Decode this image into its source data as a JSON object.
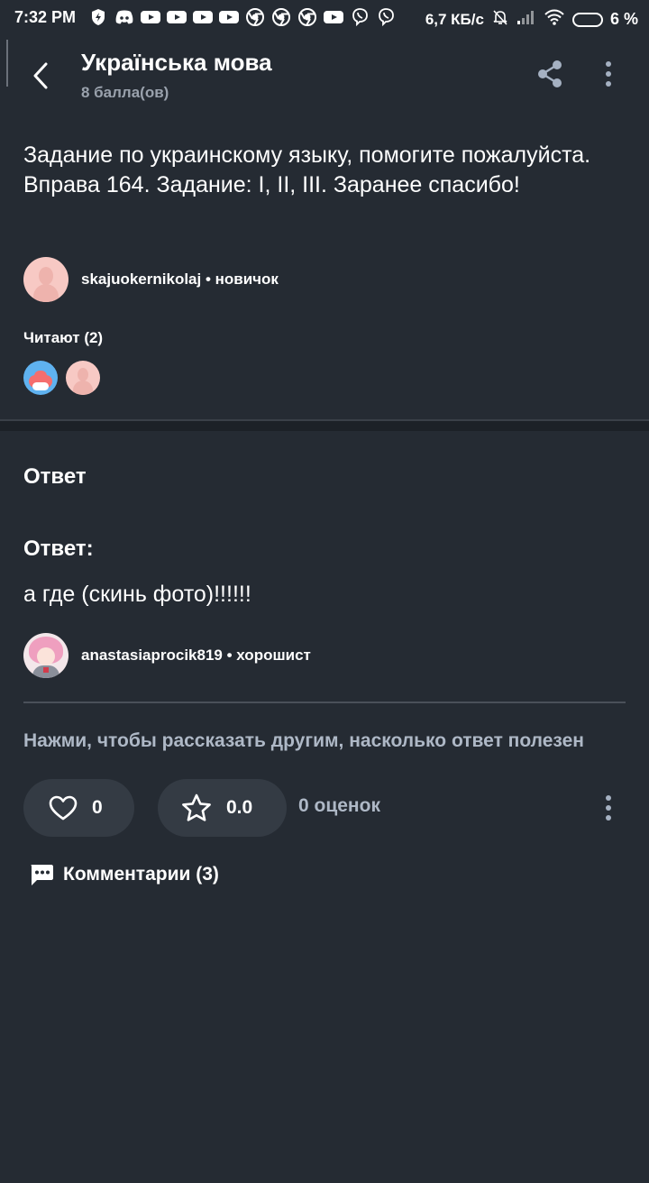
{
  "status_bar": {
    "time": "7:32 PM",
    "net_speed": "6,7 КБ/с",
    "battery": "6 %",
    "notification_icons": [
      "shield-bolt-icon",
      "discord-icon",
      "youtube-icon",
      "youtube-icon",
      "youtube-icon",
      "youtube-icon",
      "chrome-icon",
      "chrome-icon",
      "chrome-icon",
      "youtube-icon",
      "viber-icon",
      "viber-icon"
    ]
  },
  "header": {
    "title": "Українська мова",
    "points": "8 балла(ов)"
  },
  "question": {
    "text": "Задание по украинскому языку, помогите пожалуйста. Вправа 164. Задание: I, II, III. Заранее спасибо!",
    "author": "skajuokernikolaj • новичок"
  },
  "readers": {
    "label": "Читают (2)"
  },
  "answer": {
    "heading": "Ответ",
    "label": "Ответ:",
    "text": "а где (скинь фото)!!!!!!",
    "author": "anastasiaprocik819 • хорошист"
  },
  "rating": {
    "prompt": "Нажми, чтобы рассказать другим, насколько ответ полезен",
    "likes": "0",
    "stars": "0.0",
    "ratings_count": "0 оценок"
  },
  "comments": {
    "label": "Комментарии (3)"
  },
  "colors": {
    "background": "#252b33",
    "pill": "#343b44",
    "muted_text": "#aeb8c6"
  }
}
